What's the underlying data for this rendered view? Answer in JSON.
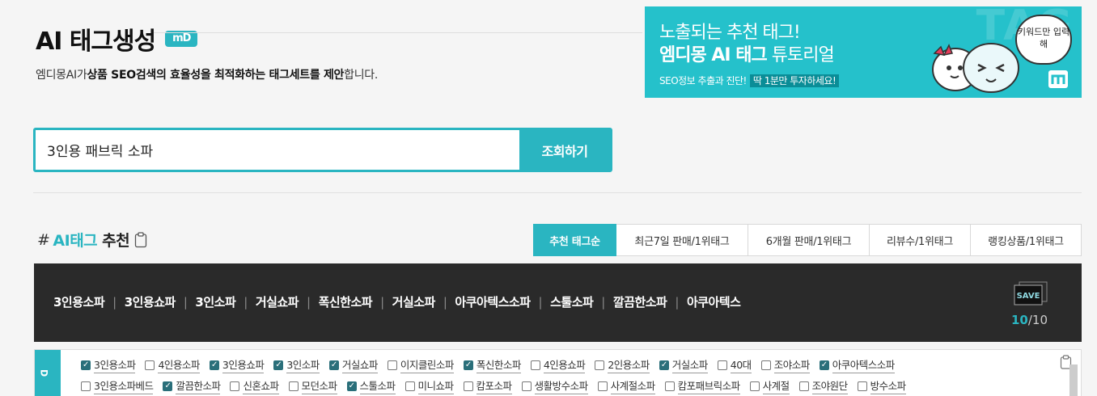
{
  "header": {
    "title": "AI 태그생성",
    "badge": "mD",
    "subtitle_parts": [
      "엠디몽AI가",
      "상품 SEO검색의 효율성을 최적화하는 태그세트를 제안",
      "합니다."
    ]
  },
  "banner": {
    "bg_text": "TAG",
    "line1": "노출되는 추천 태그!",
    "line2_bold": "엠디몽 AI 태그",
    "line2_rest": " 튜토리얼",
    "line3": "SEO정보 추출과 진단!",
    "line3_highlight": "딱 1분만 투자하세요!",
    "bubble": "키워드만 입력해"
  },
  "search": {
    "value": "3인용 패브릭 소파",
    "button": "조회하기"
  },
  "section": {
    "hash": "#",
    "ai": "AI태그",
    "rec": "추천"
  },
  "tabs": [
    {
      "label": "추천 태그순",
      "active": true
    },
    {
      "label": "최근7일 판매/1위태그",
      "active": false
    },
    {
      "label": "6개월 판매/1위태그",
      "active": false
    },
    {
      "label": "리뷰수/1위태그",
      "active": false
    },
    {
      "label": "랭킹상품/1위태그",
      "active": false
    }
  ],
  "selected_tags": [
    "3인용소파",
    "3인용쇼파",
    "3인소파",
    "거실쇼파",
    "폭신한소파",
    "거실소파",
    "아쿠아텍스소파",
    "스툴소파",
    "깔끔한소파",
    "아쿠아텍스"
  ],
  "save": {
    "label": "SAVE",
    "count": "10",
    "total": "/10"
  },
  "tag_rows": [
    [
      {
        "label": "3인용소파",
        "checked": true
      },
      {
        "label": "4인용소파",
        "checked": false
      },
      {
        "label": "3인용쇼파",
        "checked": true
      },
      {
        "label": "3인소파",
        "checked": true
      },
      {
        "label": "거실쇼파",
        "checked": true
      },
      {
        "label": "이지클린소파",
        "checked": false
      },
      {
        "label": "폭신한소파",
        "checked": true
      },
      {
        "label": "4인용쇼파",
        "checked": false
      },
      {
        "label": "2인용소파",
        "checked": false
      },
      {
        "label": "거실소파",
        "checked": true
      },
      {
        "label": "40대",
        "checked": false
      },
      {
        "label": "조야소파",
        "checked": false
      },
      {
        "label": "아쿠아텍스소파",
        "checked": true
      }
    ],
    [
      {
        "label": "3인용소파베드",
        "checked": false
      },
      {
        "label": "깔끔한소파",
        "checked": true
      },
      {
        "label": "신혼쇼파",
        "checked": false
      },
      {
        "label": "모던소파",
        "checked": false
      },
      {
        "label": "스툴소파",
        "checked": true
      },
      {
        "label": "미니쇼파",
        "checked": false
      },
      {
        "label": "캄포소파",
        "checked": false
      },
      {
        "label": "생활방수소파",
        "checked": false
      },
      {
        "label": "사계절소파",
        "checked": false
      },
      {
        "label": "캄포패브릭소파",
        "checked": false
      },
      {
        "label": "사계절",
        "checked": false
      },
      {
        "label": "조야원단",
        "checked": false
      },
      {
        "label": "방수소파",
        "checked": false
      }
    ]
  ],
  "colors": {
    "accent": "#2ab5c1",
    "dark_bar": "#2a2a2a",
    "checkbox_on": "#2a6f7a"
  }
}
